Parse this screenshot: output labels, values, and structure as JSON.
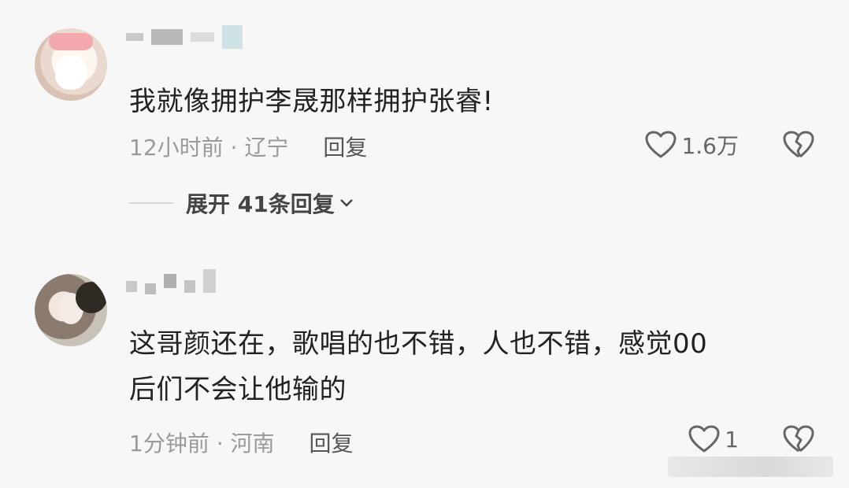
{
  "comments": [
    {
      "text": "我就像拥护李晟那样拥护张睿!",
      "time_location": "12小时前 · 辽宁",
      "reply_label": "回复",
      "likes": "1.6万",
      "expand_label": "展开 41条回复"
    },
    {
      "text": "这哥颜还在，歌唱的也不错，人也不错，感觉00\n后们不会让他输的",
      "time_location": "1分钟前 · 河南",
      "reply_label": "回复",
      "likes": "1"
    }
  ],
  "icons": {
    "like": "heart-outline-icon",
    "dislike": "broken-heart-icon",
    "expand": "chevron-down-icon"
  },
  "colors": {
    "background": "#f7f7f7",
    "text": "#222222",
    "meta": "#9a9a9a"
  }
}
